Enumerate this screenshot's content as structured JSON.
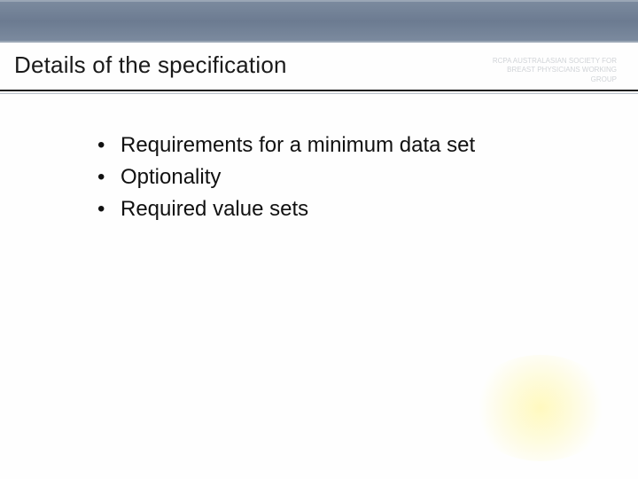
{
  "header": {
    "title": "Details of the specification",
    "org_lines": [
      "RCPA AUSTRALASIAN SOCIETY FOR",
      "BREAST PHYSICIANS WORKING",
      "GROUP"
    ]
  },
  "bullets": [
    "Requirements for a minimum data set",
    "Optionality",
    "Required value sets"
  ]
}
